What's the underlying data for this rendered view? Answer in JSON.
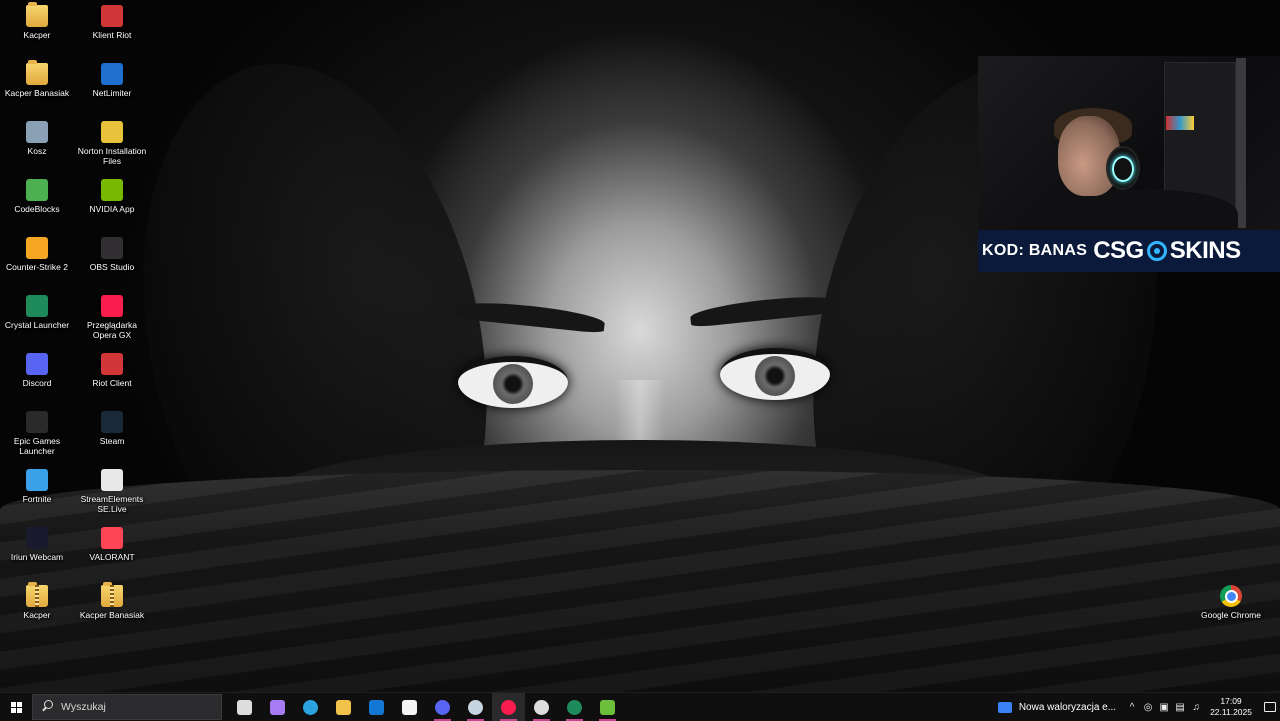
{
  "desktop": {
    "icons_col1": [
      {
        "label": "Kacper",
        "icon": "folder-icon",
        "color": "#e8b34a"
      },
      {
        "label": "Kacper Banasiak",
        "icon": "folder-icon",
        "color": "#e8b34a"
      },
      {
        "label": "Kosz",
        "icon": "recycle-bin-icon",
        "color": "#8aa0b4"
      },
      {
        "label": "CodeBlocks",
        "icon": "codeblocks-icon",
        "color": "#4caf50"
      },
      {
        "label": "Counter-Strike 2",
        "icon": "counter-strike-icon",
        "color": "#f5a623"
      },
      {
        "label": "Crystal Launcher",
        "icon": "crystal-launcher-icon",
        "color": "#1f8a5a"
      },
      {
        "label": "Discord",
        "icon": "discord-icon",
        "color": "#5865f2"
      },
      {
        "label": "Epic Games Launcher",
        "icon": "epic-games-icon",
        "color": "#2a2a2a"
      },
      {
        "label": "Fortnite",
        "icon": "fortnite-icon",
        "color": "#3aa0e8"
      },
      {
        "label": "Iriun Webcam",
        "icon": "webcam-icon",
        "color": "#1a1a2e"
      },
      {
        "label": "Kacper",
        "icon": "zip-folder-icon",
        "color": "#e8b34a"
      }
    ],
    "icons_col2": [
      {
        "label": "Klient Riot",
        "icon": "riot-icon",
        "color": "#d13639"
      },
      {
        "label": "NetLimiter",
        "icon": "netlimiter-icon",
        "color": "#1f6fd1"
      },
      {
        "label": "Norton Installation Files",
        "icon": "norton-folder-icon",
        "color": "#e8c23a"
      },
      {
        "label": "NVIDIA App",
        "icon": "nvidia-icon",
        "color": "#76b900"
      },
      {
        "label": "OBS Studio",
        "icon": "obs-icon",
        "color": "#302e31"
      },
      {
        "label": "Przeglądarka Opera GX",
        "icon": "opera-gx-icon",
        "color": "#fa1e4e"
      },
      {
        "label": "Riot Client",
        "icon": "riot-icon",
        "color": "#d13639"
      },
      {
        "label": "Steam",
        "icon": "steam-icon",
        "color": "#1b2838"
      },
      {
        "label": "StreamElements SE.Live",
        "icon": "streamelements-icon",
        "color": "#e8e8e8"
      },
      {
        "label": "VALORANT",
        "icon": "valorant-icon",
        "color": "#fd4556"
      },
      {
        "label": "Kacper Banasiak",
        "icon": "zip-folder-icon",
        "color": "#e8b34a"
      }
    ],
    "icon_right": {
      "label": "Google Chrome",
      "icon": "chrome-icon"
    }
  },
  "overlay": {
    "code_label": "KOD: BANAS",
    "logo_left": "CSG",
    "logo_right": "SKINS",
    "accent": "#33b4ff"
  },
  "taskbar": {
    "search_placeholder": "Wyszukaj",
    "apps": [
      {
        "name": "task-view-icon",
        "color": "#dddddd"
      },
      {
        "name": "copilot-icon",
        "color": "#a77cf2"
      },
      {
        "name": "edge-icon",
        "color": "#2aa3e0"
      },
      {
        "name": "file-explorer-icon",
        "color": "#f0c24a"
      },
      {
        "name": "outlook-icon",
        "color": "#1477d4"
      },
      {
        "name": "notepad-icon",
        "color": "#f4f4f4"
      },
      {
        "name": "discord-icon",
        "color": "#5865f2"
      },
      {
        "name": "steam-icon",
        "color": "#c7d5e0"
      },
      {
        "name": "opera-gx-icon",
        "color": "#fa1e4e"
      },
      {
        "name": "obs-icon",
        "color": "#dddddd"
      },
      {
        "name": "crystal-launcher-icon",
        "color": "#1f8a5a"
      },
      {
        "name": "minecraft-icon",
        "color": "#6bbf3a"
      }
    ],
    "news_text": "Nowa waloryzacja e...",
    "time": "17:09",
    "date": "22.11.2025"
  }
}
